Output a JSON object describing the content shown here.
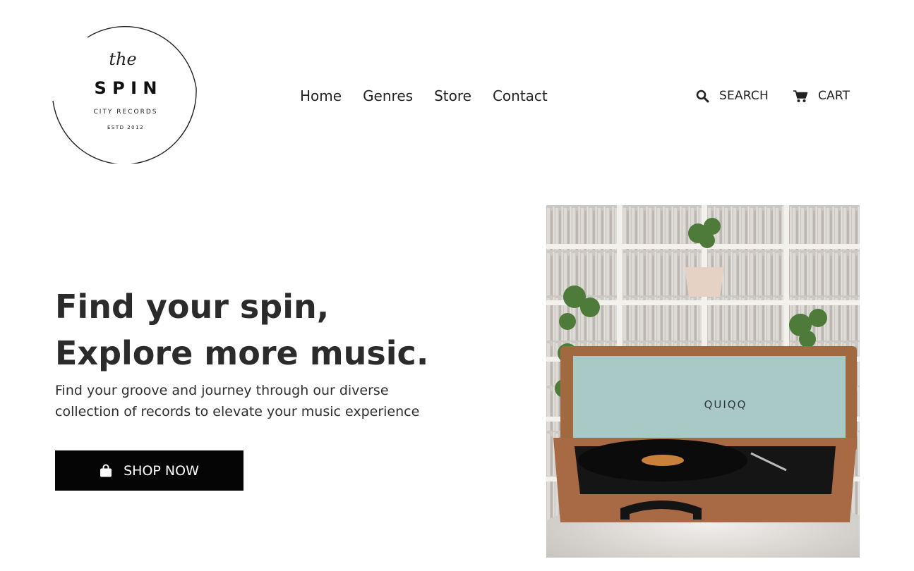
{
  "brand": {
    "script": "the",
    "name": "S P I N",
    "tagline": "CITY RECORDS",
    "established": "ESTD 2012"
  },
  "nav": {
    "items": [
      {
        "label": "Home"
      },
      {
        "label": "Genres"
      },
      {
        "label": "Store"
      },
      {
        "label": "Contact"
      }
    ]
  },
  "utilities": {
    "search": {
      "label": "SEARCH",
      "icon": "search-icon"
    },
    "cart": {
      "label": "CART",
      "icon": "cart-icon"
    }
  },
  "hero": {
    "title_line1": "Find your spin,",
    "title_line2": "Explore more music.",
    "subtitle": "Find your groove and journey through our diverse collection of records to elevate your music experience",
    "cta": {
      "label": "SHOP NOW",
      "icon": "shopping-bag-icon"
    },
    "image": {
      "brand_text": "QUIQQ"
    }
  },
  "colors": {
    "background": "#ffffff",
    "text": "#222222",
    "button_bg": "#050505",
    "button_text": "#ffffff",
    "turntable_case": "#a86a45",
    "turntable_lid": "#a9c9c7"
  }
}
